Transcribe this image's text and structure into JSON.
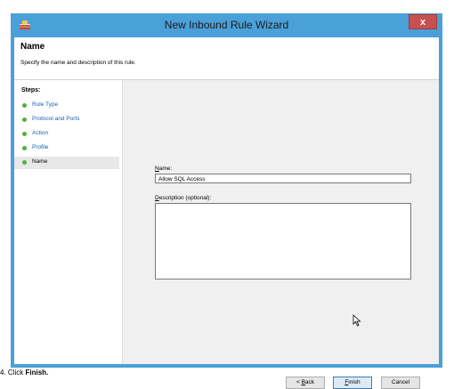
{
  "window": {
    "title": "New Inbound Rule Wizard",
    "close_label": "x"
  },
  "header": {
    "title": "Name",
    "description": "Specify the name and description of this rule."
  },
  "steps": {
    "title": "Steps:",
    "items": [
      {
        "label": "Rule Type"
      },
      {
        "label": "Protocol and Ports"
      },
      {
        "label": "Action"
      },
      {
        "label": "Profile"
      },
      {
        "label": "Name"
      }
    ],
    "active": "Name"
  },
  "form": {
    "name_label_hotkey": "N",
    "name_label_rest": "ame:",
    "name_value": "Allow SQL Access",
    "desc_label_hotkey": "D",
    "desc_label_rest": "escription (optional):",
    "desc_value": ""
  },
  "buttons": {
    "back_prefix": "< ",
    "back_hotkey": "B",
    "back_rest": "ack",
    "finish_hotkey": "F",
    "finish_rest": "inish",
    "cancel": "Cancel"
  },
  "caption": {
    "number": "4.",
    "text": "Click ",
    "bold": "Finish."
  },
  "colors": {
    "titlebar": "#4aa0d8",
    "close": "#c75050",
    "step_dot": "#4fb23a",
    "step_link": "#1a5fb4"
  },
  "icons": {
    "title_icon": "firewall-icon",
    "step_bullet": "green-dot-icon",
    "cursor": "mouse-pointer-icon"
  }
}
